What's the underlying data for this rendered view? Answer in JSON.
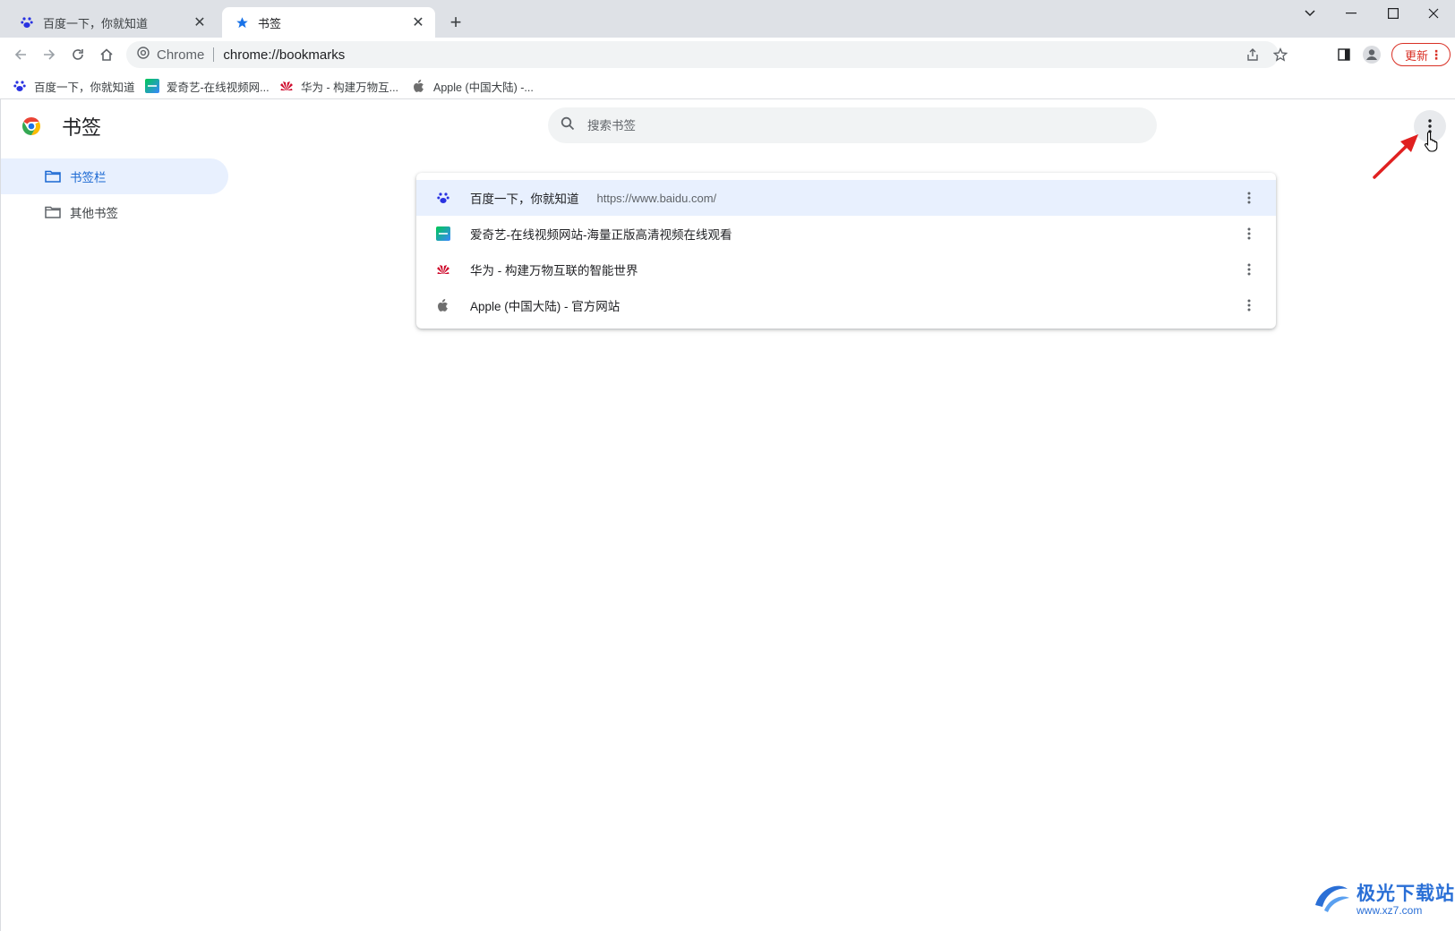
{
  "tabs": [
    {
      "title": "百度一下，你就知道",
      "icon": "baidu-paw-icon",
      "active": false
    },
    {
      "title": "书签",
      "icon": "star-icon",
      "active": true
    }
  ],
  "toolbar": {
    "omnibox_chip": "Chrome",
    "omnibox_url": "chrome://bookmarks",
    "update_label": "更新"
  },
  "bookmarks_bar": [
    {
      "label": "百度一下，你就知道",
      "icon": "baidu-paw-icon"
    },
    {
      "label": "爱奇艺-在线视频网...",
      "icon": "iqiyi-icon"
    },
    {
      "label": "华为 - 构建万物互...",
      "icon": "huawei-icon"
    },
    {
      "label": "Apple (中国大陆) -...",
      "icon": "apple-icon"
    }
  ],
  "page": {
    "title": "书签",
    "search_placeholder": "搜索书签"
  },
  "sidebar": [
    {
      "label": "书签栏",
      "selected": true
    },
    {
      "label": "其他书签",
      "selected": false
    }
  ],
  "bookmarks": [
    {
      "title": "百度一下，你就知道",
      "url": "https://www.baidu.com/",
      "icon": "baidu-paw-icon",
      "selected": true
    },
    {
      "title": "爱奇艺-在线视频网站-海量正版高清视频在线观看",
      "url": "",
      "icon": "iqiyi-icon",
      "selected": false
    },
    {
      "title": "华为 - 构建万物互联的智能世界",
      "url": "",
      "icon": "huawei-icon",
      "selected": false
    },
    {
      "title": "Apple (中国大陆) - 官方网站",
      "url": "",
      "icon": "apple-icon",
      "selected": false
    }
  ],
  "watermark": {
    "main": "极光下载站",
    "sub": "www.xz7.com"
  },
  "colors": {
    "accent": "#1a73e8",
    "selected_bg": "#e8f0fe",
    "update_red": "#d93025",
    "annotation_arrow": "#e02020"
  }
}
